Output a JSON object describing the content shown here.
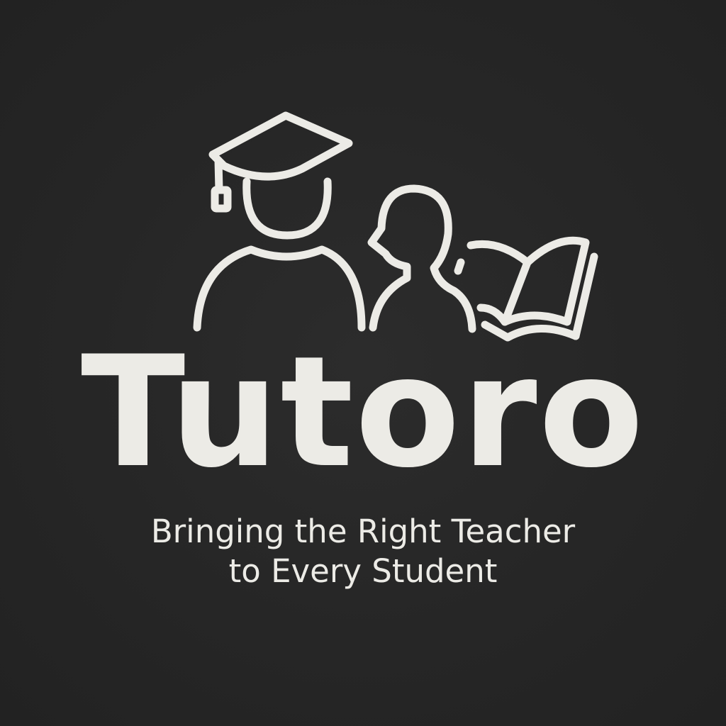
{
  "logo": {
    "name": "Tutoro",
    "tagline_line1": "Bringing the Right Teacher",
    "tagline_line2": "to Every Student",
    "icons": [
      "graduation-cap-icon",
      "teacher-icon",
      "student-icon",
      "open-book-icon"
    ]
  },
  "colors": {
    "background": "#262626",
    "foreground": "#ecebe6"
  }
}
